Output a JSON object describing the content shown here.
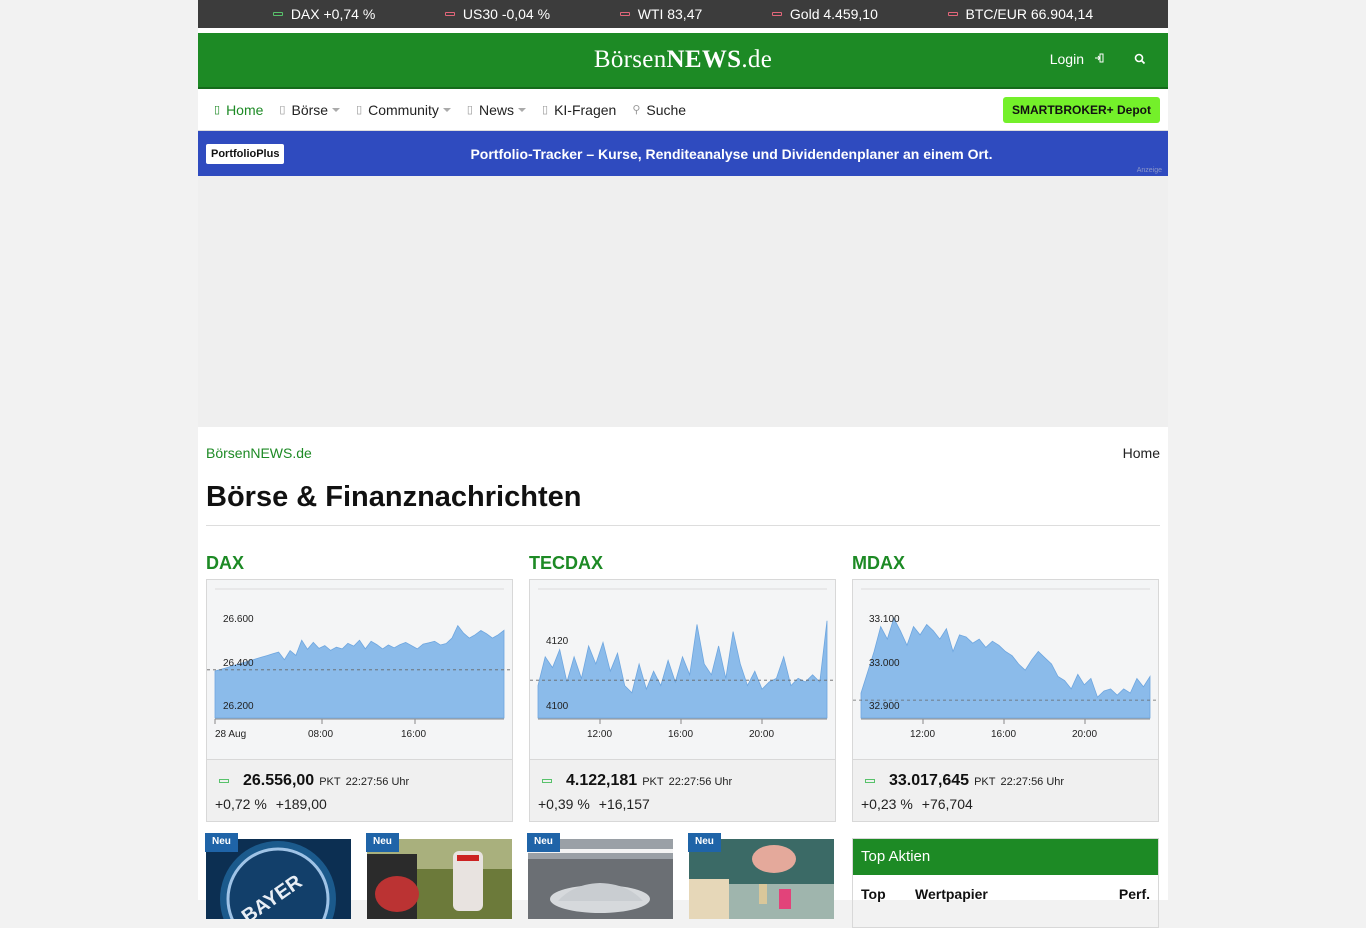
{
  "ticker": [
    {
      "name": "DAX",
      "value": "+0,74 %",
      "dir": "up"
    },
    {
      "name": "US30",
      "value": "-0,04 %",
      "dir": "down"
    },
    {
      "name": "WTI",
      "value": "83,47",
      "dir": "down"
    },
    {
      "name": "Gold",
      "value": "4.459,10",
      "dir": "down"
    },
    {
      "name": "BTC/EUR",
      "value": "66.904,14",
      "dir": "down"
    }
  ],
  "header": {
    "logo_part1": "Börsen",
    "logo_part2": "NEWS",
    "logo_part3": ".de",
    "login_label": "Login",
    "login_icon": "sign-in-icon",
    "search_icon": "search-icon"
  },
  "nav": {
    "items": [
      {
        "label": "Home",
        "icon": "home-icon"
      },
      {
        "label": "Börse",
        "icon": "chart-icon"
      },
      {
        "label": "Community",
        "icon": "users-icon"
      },
      {
        "label": "News",
        "icon": "newspaper-icon"
      },
      {
        "label": "KI-Fragen",
        "icon": "question-icon"
      },
      {
        "label": "Suche",
        "icon": "search-icon"
      }
    ],
    "cta": "SMARTBROKER+ Depot"
  },
  "banner": {
    "tag": "PortfolioPlus",
    "text": "Portfolio-Tracker – Kurse, Renditeanalyse und Dividendenplaner an einem Ort.",
    "ad_label": "Anzeige"
  },
  "breadcrumb": {
    "left": "BörsenNEWS.de",
    "right": "Home"
  },
  "page_title": "Börse & Finanznachrichten",
  "indices": [
    {
      "name": "DAX",
      "value": "26.556,00",
      "exchange": "PKT",
      "time": "22:27:56 Uhr",
      "pct": "+0,72 %",
      "abs": "+189,00"
    },
    {
      "name": "TECDAX",
      "value": "4.122,181",
      "exchange": "PKT",
      "time": "22:27:56 Uhr",
      "pct": "+0,39 %",
      "abs": "+16,157"
    },
    {
      "name": "MDAX",
      "value": "33.017,645",
      "exchange": "PKT",
      "time": "22:27:56 Uhr",
      "pct": "+0,23 %",
      "abs": "+76,704"
    }
  ],
  "chart_data": [
    {
      "type": "area",
      "title": "DAX",
      "y_ticks": [
        "26.600",
        "26.400",
        "26.200"
      ],
      "x_ticks": [
        "28 Aug",
        "08:00",
        "16:00"
      ],
      "ylim": [
        26150,
        26650
      ],
      "reference_line": 26373,
      "x": [
        0,
        1,
        2,
        3,
        4,
        5,
        6,
        7,
        8,
        9,
        10,
        11,
        12,
        13,
        14,
        15,
        16,
        17,
        18,
        19,
        20,
        21,
        22,
        23,
        24,
        25,
        26,
        27,
        28,
        29,
        30,
        31,
        32,
        33,
        34,
        35,
        36,
        37,
        38,
        39,
        40,
        41,
        42,
        43,
        44,
        45,
        46,
        47,
        48,
        49,
        50
      ],
      "values": [
        26367,
        26375,
        26383,
        26391,
        26399,
        26407,
        26415,
        26423,
        26431,
        26439,
        26447,
        26455,
        26420,
        26462,
        26440,
        26510,
        26468,
        26500,
        26472,
        26485,
        26463,
        26478,
        26470,
        26496,
        26483,
        26510,
        26470,
        26505,
        26490,
        26470,
        26488,
        26475,
        26490,
        26500,
        26485,
        26470,
        26492,
        26498,
        26505,
        26488,
        26495,
        26520,
        26578,
        26543,
        26520,
        26535,
        26555,
        26540,
        26520,
        26535,
        26556
      ],
      "grid": false,
      "legend": "none",
      "color": "#8bbbea"
    },
    {
      "type": "area",
      "title": "TECDAX",
      "y_ticks": [
        "4120",
        "4100"
      ],
      "x_ticks": [
        "12:00",
        "16:00",
        "20:00"
      ],
      "ylim": [
        4095,
        4125
      ],
      "reference_line": 4105.5,
      "x": [
        0,
        1,
        2,
        3,
        4,
        5,
        6,
        7,
        8,
        9,
        10,
        11,
        12,
        13,
        14,
        15,
        16,
        17,
        18,
        19,
        20,
        21,
        22,
        23,
        24,
        25,
        26,
        27,
        28,
        29,
        30,
        31,
        32,
        33,
        34,
        35,
        36,
        37,
        38,
        39,
        40
      ],
      "values": [
        4104,
        4112,
        4109,
        4114,
        4105,
        4112,
        4106,
        4115,
        4110,
        4116,
        4108,
        4113,
        4104,
        4102,
        4110,
        4103,
        4108,
        4104,
        4111,
        4105,
        4112,
        4107,
        4121,
        4110,
        4107,
        4115,
        4106,
        4119,
        4110,
        4104,
        4108,
        4103,
        4105,
        4106,
        4112,
        4104,
        4106,
        4105,
        4107,
        4105,
        4122
      ],
      "grid": false,
      "legend": "none",
      "color": "#8bbbea"
    },
    {
      "type": "area",
      "title": "MDAX",
      "y_ticks": [
        "33.100",
        "33.000",
        "32.900"
      ],
      "x_ticks": [
        "12:00",
        "16:00",
        "20:00"
      ],
      "ylim": [
        32860,
        33120
      ],
      "reference_line": 32903,
      "x": [
        0,
        1,
        2,
        3,
        4,
        5,
        6,
        7,
        8,
        9,
        10,
        11,
        12,
        13,
        14,
        15,
        16,
        17,
        18,
        19,
        20,
        21,
        22,
        23,
        24,
        25,
        26,
        27,
        28,
        29,
        30,
        31,
        32,
        33,
        34,
        35,
        36,
        37,
        38,
        39,
        40,
        41,
        42,
        43,
        44
      ],
      "values": [
        32920,
        32970,
        33020,
        33080,
        33050,
        33100,
        33070,
        33035,
        33080,
        33060,
        33085,
        33070,
        33050,
        33075,
        33020,
        33060,
        33055,
        33040,
        33050,
        33030,
        33045,
        33035,
        33020,
        33010,
        32990,
        32975,
        33000,
        33020,
        33005,
        32990,
        32960,
        32950,
        32930,
        32965,
        32940,
        32955,
        32910,
        32925,
        32930,
        32915,
        32930,
        32920,
        32955,
        32935,
        32960
      ],
      "grid": false,
      "legend": "none",
      "color": "#8bbbea"
    }
  ],
  "news_badge": "Neu",
  "news": [
    {
      "image": "bayer-logo-photo"
    },
    {
      "image": "tesla-charger-photo"
    },
    {
      "image": "car-studio-photo"
    },
    {
      "image": "coins-hand-photo"
    }
  ],
  "top_aktien": {
    "title": "Top Aktien",
    "columns": [
      "Top",
      "Wertpapier",
      "Perf."
    ]
  }
}
